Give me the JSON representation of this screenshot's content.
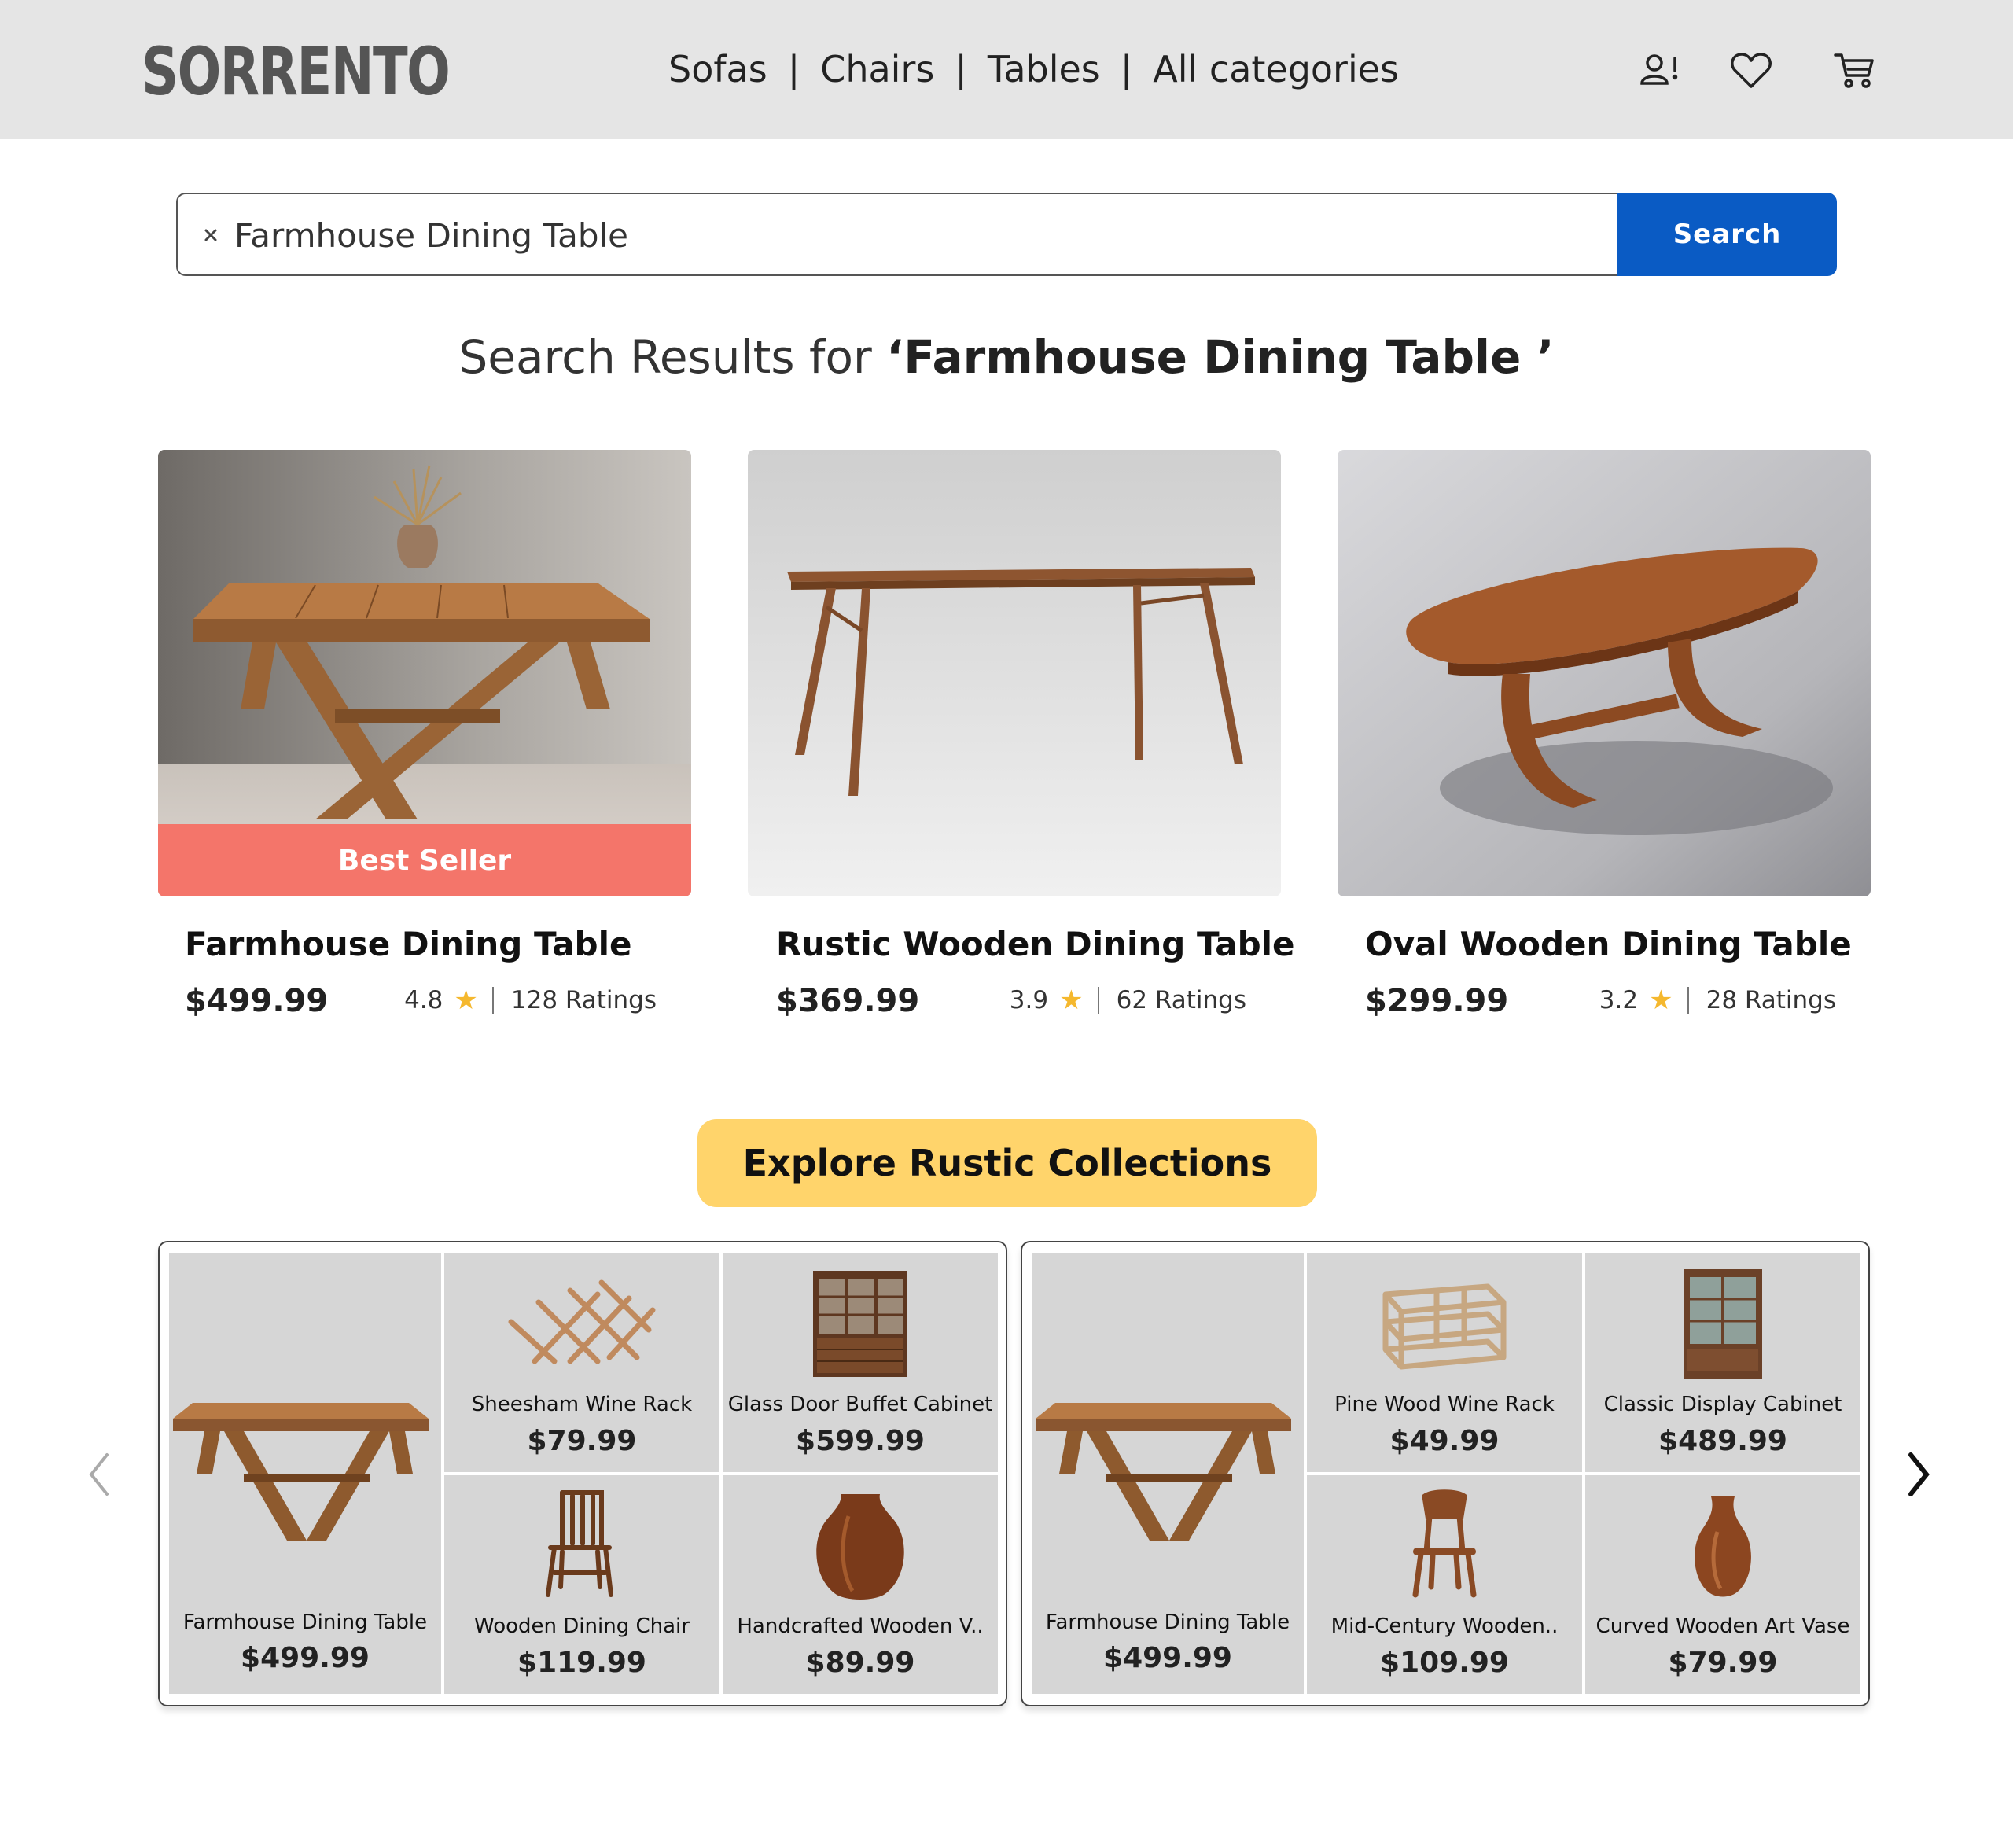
{
  "header": {
    "logo": "SORRENTO",
    "nav": [
      "Sofas",
      "Chairs",
      "Tables",
      "All categories"
    ],
    "separator": "|",
    "icons": [
      "user-alert-icon",
      "heart-icon",
      "cart-icon"
    ]
  },
  "search": {
    "value": "Farmhouse Dining Table",
    "button_label": "Search",
    "clear_glyph": "×"
  },
  "results": {
    "prefix": "Search Results for ",
    "query_display": "‘Farmhouse Dining Table ’"
  },
  "products": [
    {
      "name": "Farmhouse Dining Table",
      "price": "$499.99",
      "rating": "4.8",
      "ratings_count": "128 Ratings",
      "badge": "Best Seller"
    },
    {
      "name": "Rustic Wooden Dining Table",
      "price": "$369.99",
      "rating": "3.9",
      "ratings_count": "62 Ratings"
    },
    {
      "name": "Oval Wooden Dining Table",
      "price": "$299.99",
      "rating": "3.2",
      "ratings_count": "28 Ratings"
    }
  ],
  "explore": {
    "label": "Explore Rustic Collections"
  },
  "collections": [
    {
      "items": [
        {
          "name": "Farmhouse Dining Table",
          "price": "$499.99"
        },
        {
          "name": "Sheesham Wine Rack",
          "price": "$79.99"
        },
        {
          "name": "Glass Door Buffet Cabinet",
          "price": "$599.99"
        },
        {
          "name": "Wooden Dining Chair",
          "price": "$119.99"
        },
        {
          "name": "Handcrafted Wooden V..",
          "price": "$89.99"
        }
      ]
    },
    {
      "items": [
        {
          "name": "Farmhouse Dining Table",
          "price": "$499.99"
        },
        {
          "name": "Pine Wood Wine Rack",
          "price": "$49.99"
        },
        {
          "name": "Classic Display Cabinet",
          "price": "$489.99"
        },
        {
          "name": "Mid-Century Wooden..",
          "price": "$109.99"
        },
        {
          "name": "Curved Wooden Art Vase",
          "price": "$79.99"
        }
      ]
    }
  ],
  "colors": {
    "header_bg": "#e5e5e5",
    "search_button": "#0a5bc4",
    "badge": "#f4756a",
    "explore_button": "#ffd46b",
    "star": "#f5b82e",
    "tile_bg": "#d6d6d6"
  }
}
